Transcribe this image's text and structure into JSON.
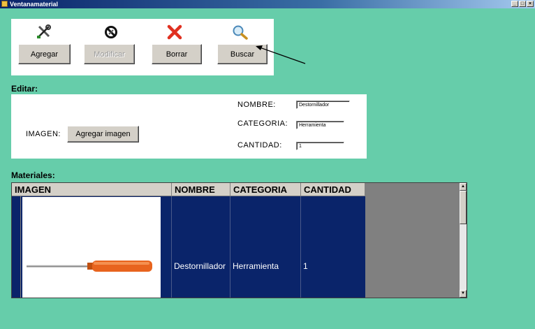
{
  "window": {
    "title": "Ventanamaterial",
    "controls": [
      "_",
      "□",
      "×"
    ]
  },
  "toolbar": {
    "agregar_label": "Agregar",
    "modificar_label": "Modificar",
    "borrar_label": "Borrar",
    "buscar_label": "Buscar",
    "icons": [
      "tools-icon",
      "no-edit-icon",
      "red-x-icon",
      "magnifier-icon"
    ]
  },
  "editar": {
    "heading": "Editar:",
    "imagen_label": "IMAGEN:",
    "agregar_imagen_label": "Agregar imagen",
    "nombre_label": "NOMBRE:",
    "nombre_value": "Destornillador",
    "categoria_label": "CATEGORIA:",
    "categoria_value": "Herramienta",
    "cantidad_label": "CANTIDAD:",
    "cantidad_value": "1"
  },
  "materiales": {
    "heading": "Materiales:",
    "columns": [
      "IMAGEN",
      "NOMBRE",
      "CATEGORIA",
      "CANTIDAD"
    ],
    "rows": [
      {
        "imagen": "screwdriver-image",
        "nombre": "Destornillador",
        "categoria": "Herramienta",
        "cantidad": "1"
      }
    ]
  },
  "colors": {
    "background": "#66cdaa",
    "selected_row": "#0a246a",
    "grid_empty": "#808080"
  }
}
